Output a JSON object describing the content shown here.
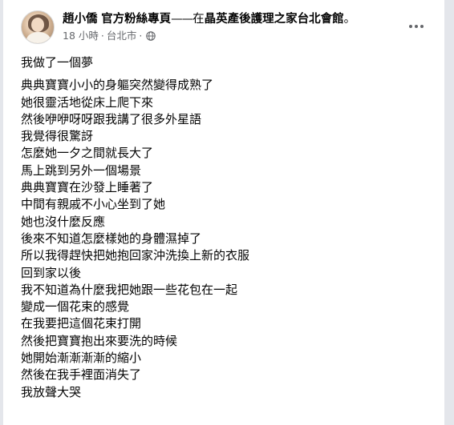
{
  "post": {
    "author_name": "趙小僑",
    "page_name": "官方粉絲專頁",
    "at_text": "在",
    "location_name": "晶英產後護理之家台北會館",
    "title_end": "。",
    "time": "18 小時",
    "dot": "·",
    "city": "台北市",
    "audience_icon": "globe-icon",
    "more_icon": "more-options-icon",
    "first_line": "我做了一個夢",
    "lines": [
      "典典寶寶小小的身軀突然變得成熟了",
      "她很靈活地從床上爬下來",
      "然後咿咿呀呀跟我講了很多外星語",
      "我覺得很驚訝",
      "怎麼她一夕之間就長大了",
      "馬上跳到另外一個場景",
      "典典寶寶在沙發上睡著了",
      "中間有親戚不小心坐到了她",
      "她也沒什麼反應",
      "後來不知道怎麼樣她的身體濕掉了",
      "所以我得趕快把她抱回家沖洗換上新的衣服",
      "回到家以後",
      "我不知道為什麼我把她跟一些花包在一起",
      "變成一個花束的感覺",
      "在我要把這個花束打開",
      "然後把寶寶抱出來要洗的時候",
      "她開始漸漸漸漸的縮小",
      "然後在我手裡面消失了",
      "我放聲大哭"
    ]
  }
}
